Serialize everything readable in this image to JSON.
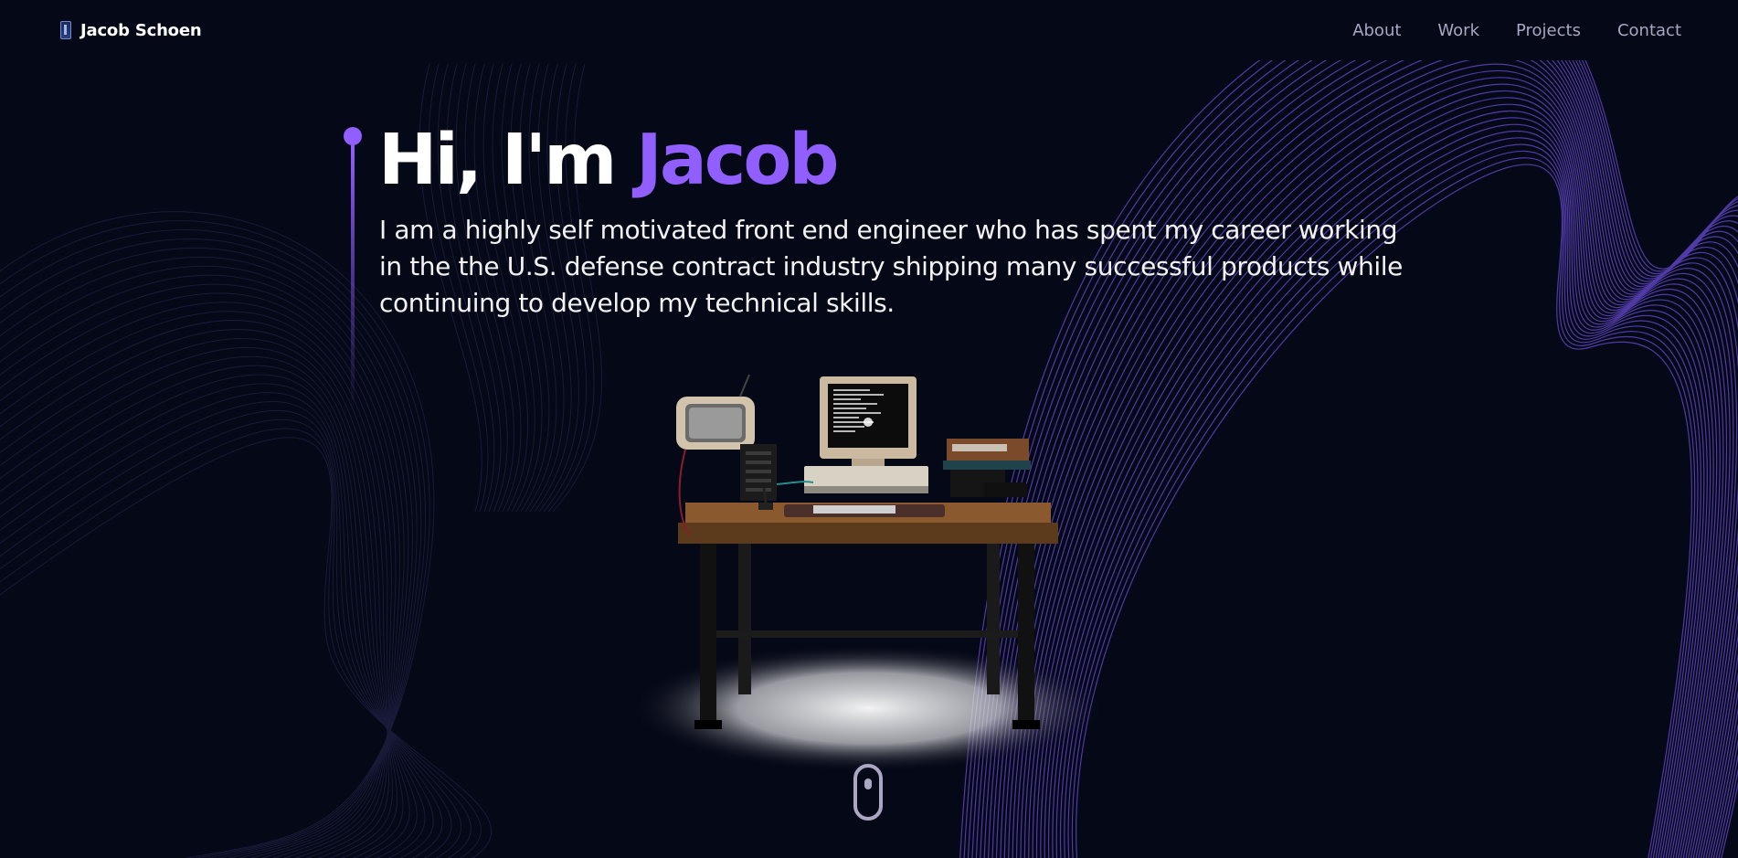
{
  "navbar": {
    "brand_name": "Jacob Schoen",
    "links": [
      {
        "label": "About"
      },
      {
        "label": "Work"
      },
      {
        "label": "Projects"
      },
      {
        "label": "Contact"
      }
    ]
  },
  "hero": {
    "greeting": "Hi, I'm ",
    "name": "Jacob",
    "subtitle": "I am a highly self motivated front end engineer who has spent my career working in the the U.S. defense contract industry shipping many successful products while continuing to develop my technical skills."
  },
  "icons": {
    "brand_logo": "phone-logo-icon",
    "scroll": "mouse-scroll-icon"
  },
  "colors": {
    "background": "#050816",
    "accent": "#915eff",
    "nav_text": "#aaa6c3",
    "text": "#ffffff"
  }
}
